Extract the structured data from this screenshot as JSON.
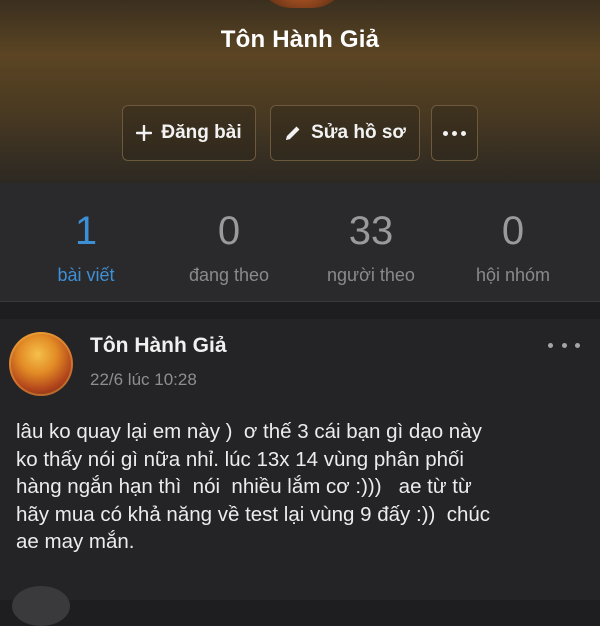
{
  "profile": {
    "name": "Tôn Hành Giả"
  },
  "actions": {
    "post_label": "Đăng bài",
    "edit_label": "Sửa hồ sơ",
    "more_icon": "more-horizontal-icon"
  },
  "stats": [
    {
      "value": "1",
      "label": "bài viết"
    },
    {
      "value": "0",
      "label": "đang theo"
    },
    {
      "value": "33",
      "label": "người theo"
    },
    {
      "value": "0",
      "label": "hội nhóm"
    }
  ],
  "post": {
    "author": "Tôn Hành Giả",
    "time": "22/6 lúc 10:28",
    "body": "lâu ko quay lại em này )  ơ thế 3 cái bạn gì dạo này\nko thấy nói gì nữa nhỉ. lúc 13x 14 vùng phân phối\nhàng ngắn hạn thì  nói  nhiều lắm cơ :)))   ae từ từ\nhãy mua có khả năng về test lại vùng 9 đấy :))  chúc\nae may mắn."
  },
  "colors": {
    "accent": "#3d8fd6",
    "background": "#1e1e20",
    "stats_background": "#2a2a2c"
  }
}
